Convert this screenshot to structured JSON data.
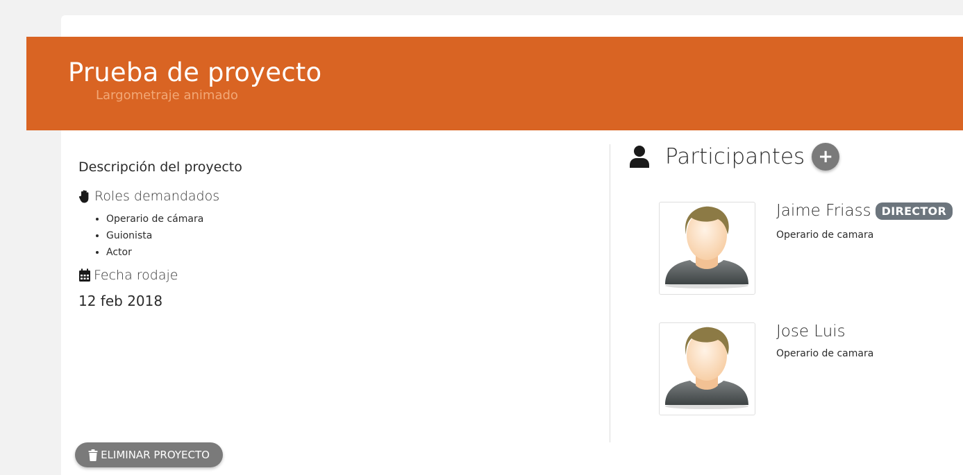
{
  "project": {
    "title": "Prueba de proyecto",
    "subtitle": "Largometraje animado",
    "banner_color": "#d96423"
  },
  "details": {
    "description_heading": "Descripción del proyecto",
    "roles_label": "Roles demandados",
    "roles_icon": "hand-icon",
    "roles": [
      "Operario de cámara",
      "Guionista",
      "Actor"
    ],
    "date_label": "Fecha rodaje",
    "date_icon": "calendar-icon",
    "date_value": "12 feb 2018"
  },
  "participants": {
    "heading": "Participantes",
    "heading_icon": "user-icon",
    "add_button_label": "+",
    "list": [
      {
        "name": "Jaime Friass",
        "badge": "DIRECTOR",
        "role": "Operario de camara"
      },
      {
        "name": "Jose Luis",
        "badge": "",
        "role": "Operario de camara"
      }
    ]
  },
  "actions": {
    "delete_label": "ELIMINAR PROYECTO",
    "delete_icon": "trash-icon"
  }
}
